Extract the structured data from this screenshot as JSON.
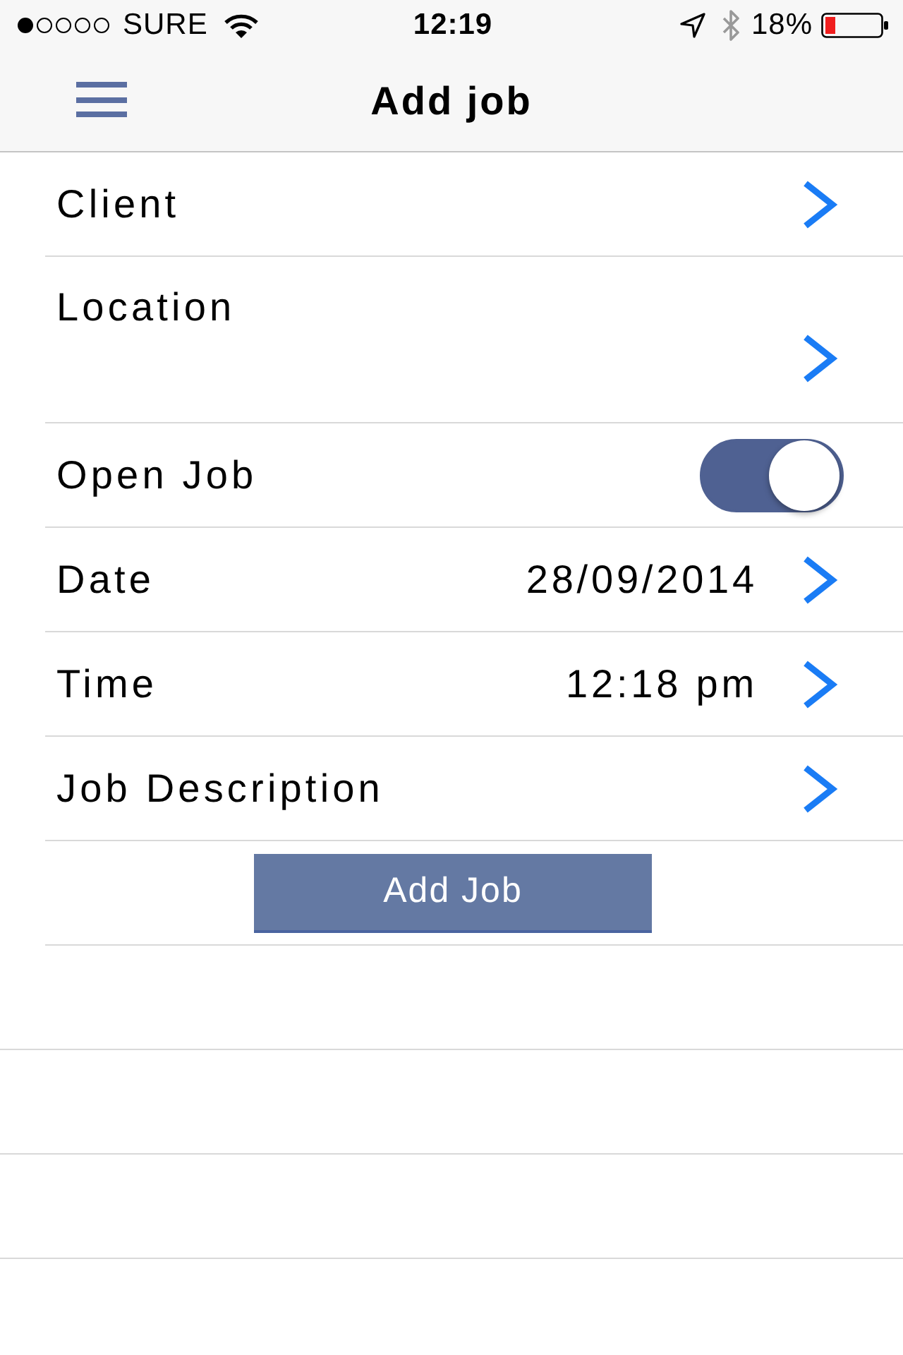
{
  "status_bar": {
    "carrier": "SURE",
    "time": "12:19",
    "battery_percent": "18%"
  },
  "nav_bar": {
    "title": "Add job"
  },
  "rows": [
    {
      "kind": "link",
      "label": "Client"
    },
    {
      "kind": "multiline",
      "label": "Location"
    },
    {
      "kind": "toggle",
      "label": "Open Job",
      "on": true
    },
    {
      "kind": "link",
      "label": "Date",
      "value": "28/09/2014"
    },
    {
      "kind": "link",
      "label": "Time",
      "value": "12:18 pm"
    },
    {
      "kind": "link",
      "label": "Job Description"
    }
  ],
  "submit_button": {
    "label": "Add Job"
  }
}
